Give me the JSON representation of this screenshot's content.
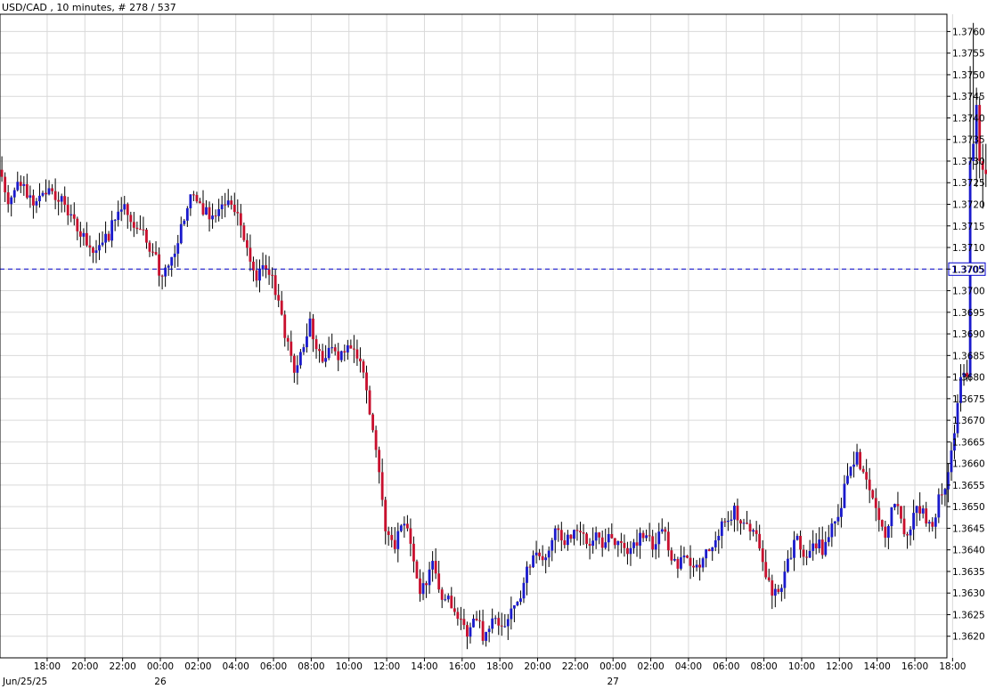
{
  "header": {
    "title": "USD/CAD , 10 minutes, # 278 / 537"
  },
  "colors": {
    "up": "#1a1acc",
    "down": "#c8102e",
    "wick": "#000000",
    "grid": "#d9d9d9",
    "current_line": "#0000cc",
    "background": "#ffffff"
  },
  "chart_data": {
    "type": "candlestick",
    "symbol": "USD/CAD",
    "interval": "10 minutes",
    "bar_counter": "# 278 / 537",
    "ylim": [
      1.3615,
      1.3764
    ],
    "y_ticks": [
      "1.3760",
      "1.3755",
      "1.3750",
      "1.3745",
      "1.3740",
      "1.3735",
      "1.3730",
      "1.3725",
      "1.3720",
      "1.3715",
      "1.3710",
      "1.3705",
      "1.3700",
      "1.3695",
      "1.3690",
      "1.3685",
      "1.3680",
      "1.3675",
      "1.3670",
      "1.3665",
      "1.3660",
      "1.3655",
      "1.3650",
      "1.3645",
      "1.3640",
      "1.3635",
      "1.3630",
      "1.3625",
      "1.3620"
    ],
    "current_price": "1.3705",
    "x_range_hours": [
      -2.5,
      47.7
    ],
    "x_ticks": [
      {
        "h": 0,
        "label": "18:00"
      },
      {
        "h": 2,
        "label": "20:00"
      },
      {
        "h": 4,
        "label": "22:00"
      },
      {
        "h": 6,
        "label": "00:00"
      },
      {
        "h": 8,
        "label": "02:00"
      },
      {
        "h": 10,
        "label": "04:00"
      },
      {
        "h": 12,
        "label": "06:00"
      },
      {
        "h": 14,
        "label": "08:00"
      },
      {
        "h": 16,
        "label": "10:00"
      },
      {
        "h": 18,
        "label": "12:00"
      },
      {
        "h": 20,
        "label": "14:00"
      },
      {
        "h": 22,
        "label": "16:00"
      },
      {
        "h": 24,
        "label": "18:00"
      },
      {
        "h": 26,
        "label": "20:00"
      },
      {
        "h": 28,
        "label": "22:00"
      },
      {
        "h": 30,
        "label": "00:00"
      },
      {
        "h": 32,
        "label": "02:00"
      },
      {
        "h": 34,
        "label": "04:00"
      },
      {
        "h": 36,
        "label": "06:00"
      },
      {
        "h": 38,
        "label": "08:00"
      },
      {
        "h": 40,
        "label": "10:00"
      },
      {
        "h": 42,
        "label": "12:00"
      },
      {
        "h": 44,
        "label": "14:00"
      },
      {
        "h": 46,
        "label": "16:00"
      },
      {
        "h": 48,
        "label": "18:00"
      }
    ],
    "date_labels": [
      {
        "h": -2.5,
        "label": "Jun/25/25"
      },
      {
        "h": 6,
        "label": "26"
      },
      {
        "h": 30,
        "label": "27"
      }
    ],
    "price_path": [
      [
        -2.4,
        1.3728
      ],
      [
        -2.0,
        1.3721
      ],
      [
        -1.3,
        1.3725
      ],
      [
        -0.7,
        1.3721
      ],
      [
        0.0,
        1.3723
      ],
      [
        0.5,
        1.3722
      ],
      [
        1.0,
        1.372
      ],
      [
        1.5,
        1.3716
      ],
      [
        2.0,
        1.3713
      ],
      [
        2.4,
        1.371
      ],
      [
        2.8,
        1.3709
      ],
      [
        3.3,
        1.3712
      ],
      [
        3.7,
        1.3716
      ],
      [
        4.1,
        1.372
      ],
      [
        4.5,
        1.3718
      ],
      [
        4.9,
        1.3715
      ],
      [
        5.4,
        1.3712
      ],
      [
        5.8,
        1.3708
      ],
      [
        6.1,
        1.3705
      ],
      [
        6.5,
        1.3704
      ],
      [
        6.8,
        1.3707
      ],
      [
        7.1,
        1.3712
      ],
      [
        7.4,
        1.3717
      ],
      [
        7.8,
        1.3723
      ],
      [
        8.2,
        1.372
      ],
      [
        8.7,
        1.3717
      ],
      [
        9.1,
        1.3719
      ],
      [
        9.5,
        1.3721
      ],
      [
        9.9,
        1.3719
      ],
      [
        10.3,
        1.3716
      ],
      [
        10.7,
        1.3712
      ],
      [
        11.0,
        1.3707
      ],
      [
        11.3,
        1.3703
      ],
      [
        11.6,
        1.3706
      ],
      [
        12.0,
        1.3704
      ],
      [
        12.3,
        1.37
      ],
      [
        12.6,
        1.3693
      ],
      [
        12.9,
        1.3688
      ],
      [
        13.2,
        1.3682
      ],
      [
        13.5,
        1.3685
      ],
      [
        13.8,
        1.3689
      ],
      [
        14.1,
        1.3692
      ],
      [
        14.4,
        1.3687
      ],
      [
        14.8,
        1.3684
      ],
      [
        15.2,
        1.3686
      ],
      [
        15.6,
        1.3684
      ],
      [
        16.0,
        1.3687
      ],
      [
        16.4,
        1.3688
      ],
      [
        16.7,
        1.3684
      ],
      [
        17.0,
        1.3678
      ],
      [
        17.3,
        1.367
      ],
      [
        17.6,
        1.3662
      ],
      [
        17.9,
        1.3652
      ],
      [
        18.2,
        1.3643
      ],
      [
        18.5,
        1.364
      ],
      [
        18.8,
        1.3644
      ],
      [
        19.1,
        1.3646
      ],
      [
        19.4,
        1.3642
      ],
      [
        19.7,
        1.3635
      ],
      [
        20.0,
        1.363
      ],
      [
        20.3,
        1.3634
      ],
      [
        20.6,
        1.3637
      ],
      [
        20.9,
        1.3632
      ],
      [
        21.2,
        1.3629
      ],
      [
        21.5,
        1.3628
      ],
      [
        21.8,
        1.3626
      ],
      [
        22.1,
        1.3623
      ],
      [
        22.4,
        1.3621
      ],
      [
        22.7,
        1.3625
      ],
      [
        23.0,
        1.3624
      ],
      [
        23.3,
        1.362
      ],
      [
        23.6,
        1.3622
      ],
      [
        23.9,
        1.3625
      ],
      [
        24.2,
        1.3622
      ],
      [
        24.5,
        1.3623
      ],
      [
        24.8,
        1.3625
      ],
      [
        25.1,
        1.3627
      ],
      [
        25.4,
        1.3632
      ],
      [
        25.7,
        1.3636
      ],
      [
        26.0,
        1.3639
      ],
      [
        26.3,
        1.364
      ],
      [
        26.6,
        1.3638
      ],
      [
        26.9,
        1.3642
      ],
      [
        27.2,
        1.3645
      ],
      [
        27.5,
        1.3641
      ],
      [
        27.8,
        1.3642
      ],
      [
        28.1,
        1.3643
      ],
      [
        28.4,
        1.3644
      ],
      [
        28.7,
        1.3641
      ],
      [
        29.0,
        1.3643
      ],
      [
        29.3,
        1.3645
      ],
      [
        29.6,
        1.3642
      ],
      [
        29.9,
        1.3643
      ],
      [
        30.2,
        1.3641
      ],
      [
        30.5,
        1.3641
      ],
      [
        30.8,
        1.364
      ],
      [
        31.1,
        1.3641
      ],
      [
        31.4,
        1.3642
      ],
      [
        31.7,
        1.3644
      ],
      [
        32.0,
        1.3643
      ],
      [
        32.3,
        1.3641
      ],
      [
        32.6,
        1.3645
      ],
      [
        32.9,
        1.3643
      ],
      [
        33.2,
        1.3639
      ],
      [
        33.5,
        1.3637
      ],
      [
        33.8,
        1.3637
      ],
      [
        34.1,
        1.3637
      ],
      [
        34.4,
        1.3637
      ],
      [
        34.7,
        1.3637
      ],
      [
        35.0,
        1.3638
      ],
      [
        35.3,
        1.364
      ],
      [
        35.6,
        1.3643
      ],
      [
        35.9,
        1.3645
      ],
      [
        36.2,
        1.3646
      ],
      [
        36.5,
        1.3649
      ],
      [
        36.8,
        1.3648
      ],
      [
        37.1,
        1.3646
      ],
      [
        37.4,
        1.3646
      ],
      [
        37.7,
        1.3643
      ],
      [
        38.0,
        1.3639
      ],
      [
        38.3,
        1.3633
      ],
      [
        38.6,
        1.363
      ],
      [
        38.9,
        1.3629
      ],
      [
        39.2,
        1.3633
      ],
      [
        39.5,
        1.3638
      ],
      [
        39.8,
        1.3642
      ],
      [
        40.1,
        1.3641
      ],
      [
        40.4,
        1.3639
      ],
      [
        40.7,
        1.3641
      ],
      [
        41.0,
        1.3642
      ],
      [
        41.3,
        1.364
      ],
      [
        41.6,
        1.3643
      ],
      [
        41.9,
        1.3646
      ],
      [
        42.2,
        1.365
      ],
      [
        42.5,
        1.3655
      ],
      [
        42.8,
        1.3658
      ],
      [
        43.1,
        1.3661
      ],
      [
        43.4,
        1.366
      ],
      [
        43.7,
        1.3656
      ],
      [
        44.0,
        1.3652
      ],
      [
        44.3,
        1.3648
      ],
      [
        44.6,
        1.3644
      ],
      [
        44.9,
        1.3648
      ],
      [
        45.2,
        1.3652
      ],
      [
        45.5,
        1.3647
      ],
      [
        45.8,
        1.3642
      ],
      [
        46.1,
        1.3647
      ],
      [
        46.4,
        1.365
      ],
      [
        46.7,
        1.3647
      ],
      [
        47.0,
        1.3645
      ],
      [
        47.3,
        1.3649
      ],
      [
        47.6,
        1.3654
      ]
    ]
  }
}
